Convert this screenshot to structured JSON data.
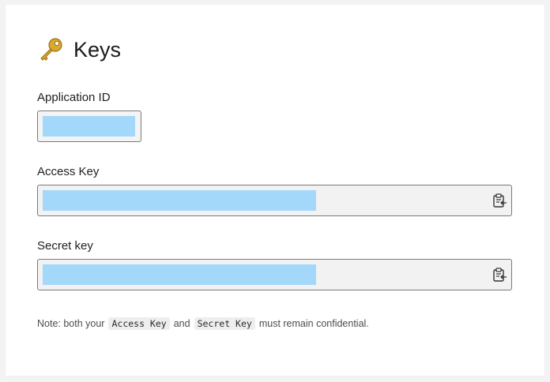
{
  "header": {
    "icon": "key-icon",
    "title": "Keys"
  },
  "fields": {
    "application_id": {
      "label": "Application ID",
      "value": ""
    },
    "access_key": {
      "label": "Access Key",
      "value": "",
      "copy_icon": "clipboard-copy-icon"
    },
    "secret_key": {
      "label": "Secret key",
      "value": "",
      "copy_icon": "clipboard-copy-icon"
    }
  },
  "note": {
    "prefix": "Note: both your",
    "code1": "Access Key",
    "middle": "and",
    "code2": "Secret Key",
    "suffix": "must remain confidential."
  },
  "colors": {
    "redaction": "#a4d8fb",
    "field_background": "#f2f2f2",
    "field_border": "#7a7a7a"
  }
}
